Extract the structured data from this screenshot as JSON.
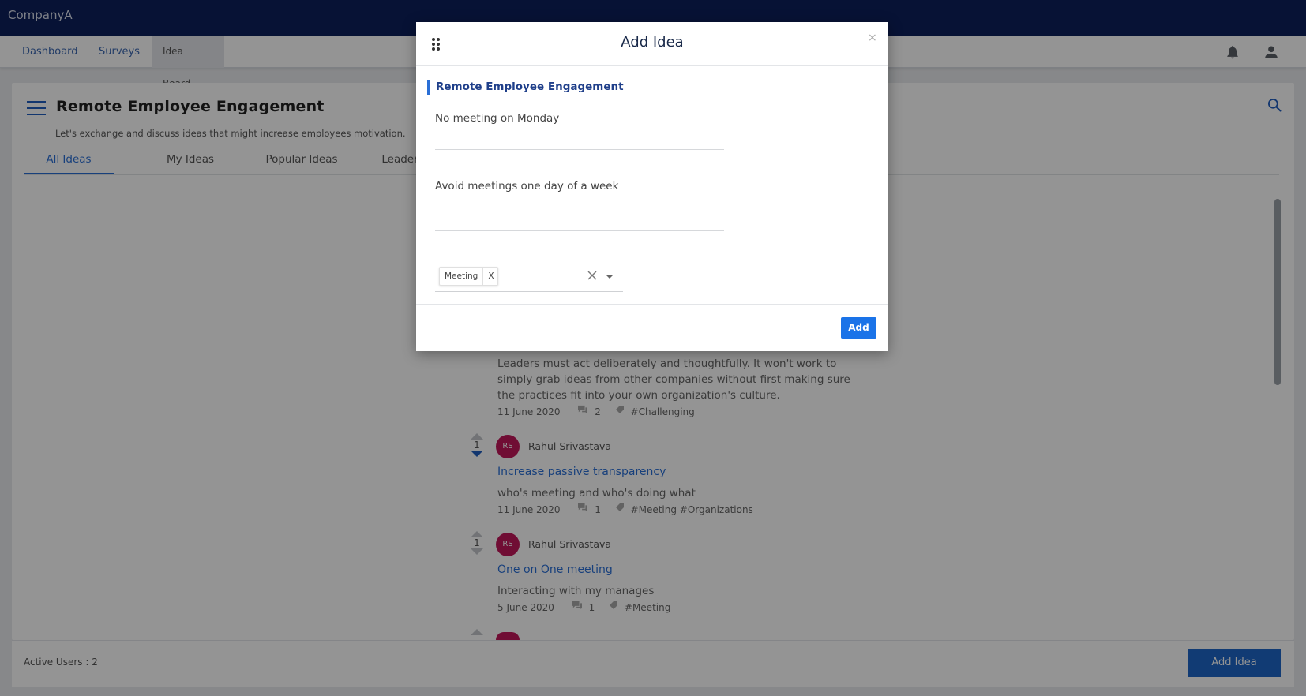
{
  "app": {
    "brand": "CompanyA"
  },
  "nav": {
    "items": [
      {
        "label": "Dashboard"
      },
      {
        "label": "Surveys"
      },
      {
        "label": "Idea Board"
      }
    ],
    "active_index": 2
  },
  "board": {
    "title": "Remote Employee Engagement",
    "subtitle": "Let's exchange and discuss ideas that might increase employees motivation.",
    "tabs": [
      {
        "label": "All Ideas"
      },
      {
        "label": "My Ideas"
      },
      {
        "label": "Popular Ideas"
      },
      {
        "label": "Leaderboard"
      }
    ],
    "active_tab": 0
  },
  "ideas": [
    {
      "body_lines": [
        "Leaders must act deliberately and thoughtfully. It won't work to",
        "simply grab ideas from other companies without first making sure",
        "the practices fit into your own organization's culture."
      ],
      "date": "11 June 2020",
      "comments": "2",
      "tags": "#Challenging"
    },
    {
      "votes": "1",
      "initials": "RS",
      "author": "Rahul Srivastava",
      "title": "Increase passive transparency",
      "body": "who's meeting and who's doing what",
      "date": "11 June 2020",
      "comments": "1",
      "tags": "#Meeting #Organizations"
    },
    {
      "votes": "1",
      "initials": "RS",
      "author": "Rahul Srivastava",
      "title": "One on One meeting",
      "body": "Interacting with my manages",
      "date": "5 June 2020",
      "comments": "1",
      "tags": "#Meeting"
    }
  ],
  "footer": {
    "active_users": "Active Users : 2",
    "add_idea_label": "Add Idea"
  },
  "modal": {
    "title": "Add Idea",
    "close_label": "×",
    "section_title": "Remote Employee Engagement",
    "idea_title_value": "No meeting on Monday",
    "idea_description_value": "Avoid meetings one day of a week",
    "tags": [
      {
        "label": "Meeting",
        "remove_label": "X"
      }
    ],
    "add_label": "Add"
  },
  "colors": {
    "topbar": "#0d1f5c",
    "accent": "#2a6fd6",
    "primary_button": "#1a73e8",
    "avatar": "#c2185b"
  }
}
